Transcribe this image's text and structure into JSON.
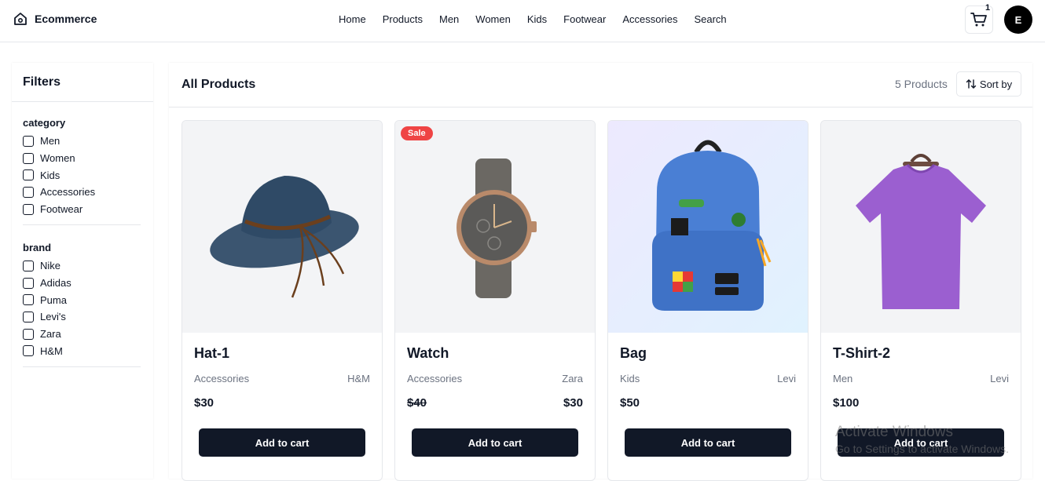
{
  "header": {
    "brand": "Ecommerce",
    "nav": [
      "Home",
      "Products",
      "Men",
      "Women",
      "Kids",
      "Footwear",
      "Accessories",
      "Search"
    ],
    "cart_count": "1",
    "avatar_initial": "E"
  },
  "sidebar": {
    "title": "Filters",
    "groups": [
      {
        "title": "category",
        "options": [
          "Men",
          "Women",
          "Kids",
          "Accessories",
          "Footwear"
        ]
      },
      {
        "title": "brand",
        "options": [
          "Nike",
          "Adidas",
          "Puma",
          "Levi's",
          "Zara",
          "H&M"
        ]
      }
    ]
  },
  "main": {
    "title": "All Products",
    "count_label": "5 Products",
    "sort_label": "Sort by"
  },
  "products": [
    {
      "name": "Hat-1",
      "category": "Accessories",
      "brand": "H&M",
      "price": "$30",
      "sale_price": "",
      "badge": "",
      "button": "Add to cart",
      "image_icon": "hat-image"
    },
    {
      "name": "Watch",
      "category": "Accessories",
      "brand": "Zara",
      "price": "$40",
      "sale_price": "$30",
      "badge": "Sale",
      "button": "Add to cart",
      "image_icon": "watch-image"
    },
    {
      "name": "Bag",
      "category": "Kids",
      "brand": "Levi",
      "price": "$50",
      "sale_price": "",
      "badge": "",
      "button": "Add to cart",
      "image_icon": "backpack-image"
    },
    {
      "name": "T-Shirt-2",
      "category": "Men",
      "brand": "Levi",
      "price": "$100",
      "sale_price": "",
      "badge": "",
      "button": "Add to cart",
      "image_icon": "tshirt-image"
    }
  ],
  "watermark": {
    "line1": "Activate Windows",
    "line2": "Go to Settings to activate Windows."
  },
  "colors": {
    "primary_button": "#111827",
    "sale_badge": "#ef4444",
    "muted_text": "#6b7280",
    "tshirt": "#9b5fd0",
    "bag": "#4a7fd4"
  }
}
